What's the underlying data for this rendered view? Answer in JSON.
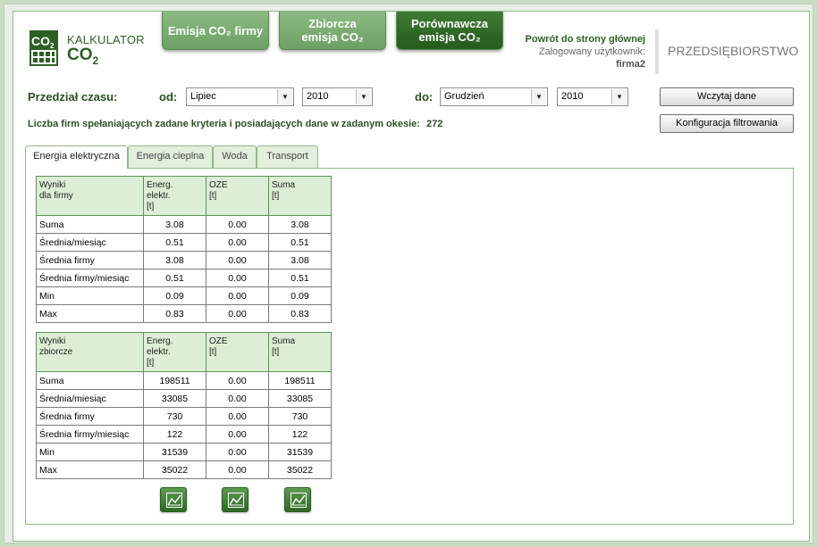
{
  "header": {
    "logo_line1": "KALKULATOR",
    "logo_line2_main": "CO",
    "logo_line2_sub": "2",
    "logo_icon_text": "CO",
    "logo_icon_sub": "2",
    "nav": [
      {
        "line1": "Emisja CO₂ firmy",
        "line2": ""
      },
      {
        "line1": "Zbiorcza",
        "line2": "emisja CO₂"
      },
      {
        "line1": "Porównawcza",
        "line2": "emisja CO₂"
      }
    ],
    "back_link": "Powrót do strony głównej",
    "logged_label": "Zalogowany użytkownik:",
    "logged_user": "firma2",
    "company": "PRZEDSIĘBIORSTWO"
  },
  "filters": {
    "period_label": "Przedział czasu:",
    "from_label": "od:",
    "from_month": "Lipiec",
    "from_year": "2010",
    "to_label": "do:",
    "to_month": "Grudzień",
    "to_year": "2010",
    "load_button": "Wczytaj dane",
    "config_button": "Konfiguracja filtrowania",
    "count_text": "Liczba firm spełaniających zadane kryteria i posiadających dane w zadanym okesie:",
    "count_value": "272"
  },
  "tabs": [
    "Energia elektryczna",
    "Energia cieplna",
    "Woda",
    "Transport"
  ],
  "table1": {
    "headers": [
      "Wyniki\ndla firmy",
      "Energ.\nelektr.\n[t]",
      "OZE\n[t]",
      "Suma\n[t]"
    ],
    "rows": [
      [
        "Suma",
        "3.08",
        "0.00",
        "3.08"
      ],
      [
        "Średnia/miesiąc",
        "0.51",
        "0.00",
        "0.51"
      ],
      [
        "Średnia firmy",
        "3.08",
        "0.00",
        "3.08"
      ],
      [
        "Średnia firmy/miesiąc",
        "0.51",
        "0.00",
        "0.51"
      ],
      [
        "Min",
        "0.09",
        "0.00",
        "0.09"
      ],
      [
        "Max",
        "0.83",
        "0.00",
        "0.83"
      ]
    ]
  },
  "table2": {
    "headers": [
      "Wyniki\nzbiorcze",
      "Energ.\nelektr.\n[t]",
      "OZE\n[t]",
      "Suma\n[t]"
    ],
    "rows": [
      [
        "Suma",
        "198511",
        "0.00",
        "198511"
      ],
      [
        "Średnia/miesiąc",
        "33085",
        "0.00",
        "33085"
      ],
      [
        "Średnia firmy",
        "730",
        "0.00",
        "730"
      ],
      [
        "Średnia firmy/miesiąc",
        "122",
        "0.00",
        "122"
      ],
      [
        "Min",
        "31539",
        "0.00",
        "31539"
      ],
      [
        "Max",
        "35022",
        "0.00",
        "35022"
      ]
    ]
  },
  "icons": {
    "chart_buttons": [
      "chart-icon",
      "chart-icon",
      "chart-icon"
    ],
    "dropdown_arrow": "chevron-down-icon"
  },
  "colors": {
    "brand_dark": "#2e5f24",
    "nav_light": "#7aad72",
    "nav_dark": "#2f6a25",
    "table_header": "#dcefd6"
  }
}
